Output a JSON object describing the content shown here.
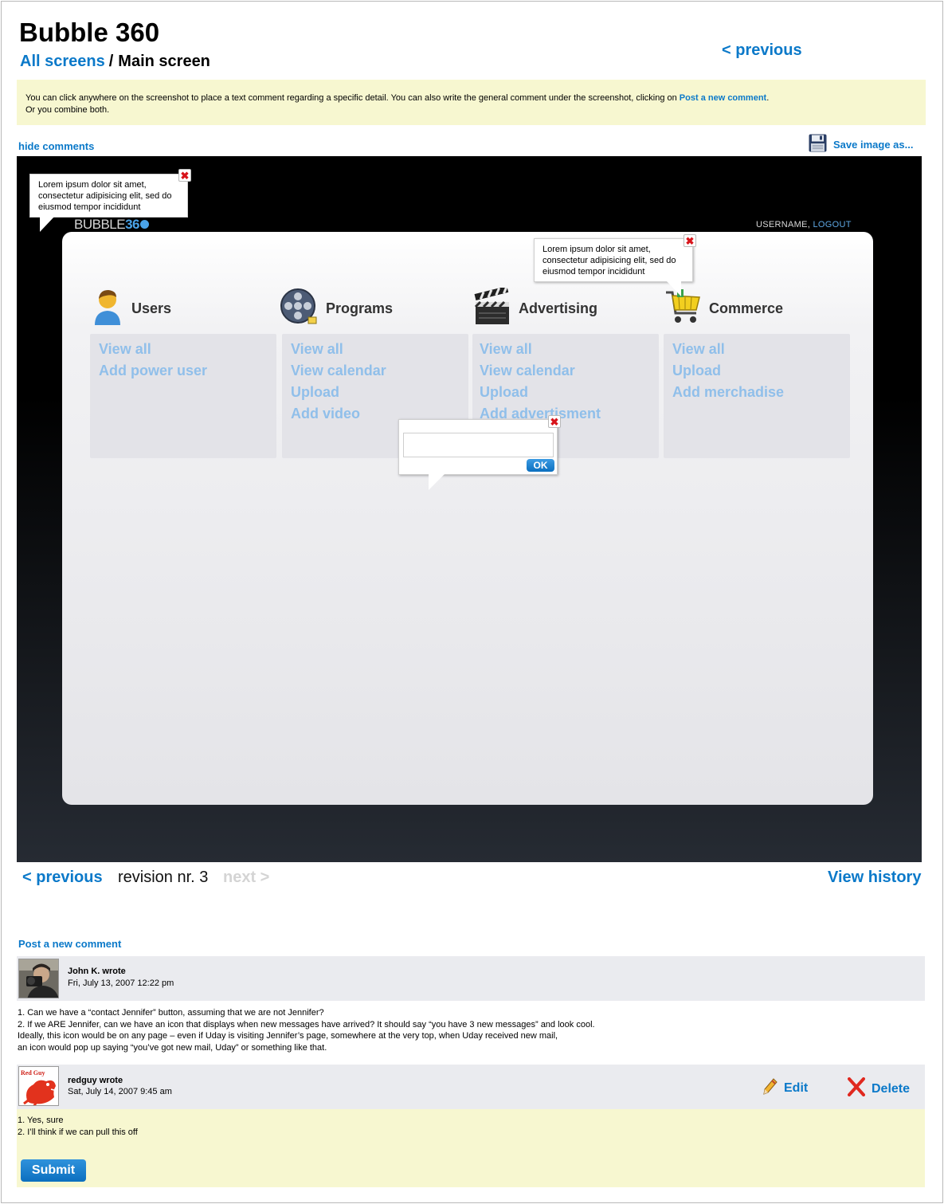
{
  "header": {
    "app_title": "Bubble 360",
    "breadcrumb_root": "All screens",
    "breadcrumb_separator": "/",
    "breadcrumb_current": "Main screen",
    "previous_label": "< previous"
  },
  "info": {
    "text_before_link": "You can click anywhere on the screenshot to place a text comment regarding a specific detail. You can also write the general comment under  the screenshot, clicking on",
    "link_label": "Post a new comment",
    "text_after_link": ".",
    "second_line": "Or you combine both."
  },
  "toolbar": {
    "hide_comments_label": "hide comments",
    "save_image_label": "Save image as...",
    "save_icon": "floppy-disk-icon"
  },
  "screenshot": {
    "logo_text": "BUBBLE",
    "logo_number": "36",
    "user_label": "USERNAME,",
    "logout_label": "LOGOUT",
    "categories": [
      {
        "title": "Users",
        "icon": "user-icon",
        "links": [
          "View all",
          "Add power user"
        ]
      },
      {
        "title": "Programs",
        "icon": "film-reel-icon",
        "links": [
          "View all",
          "View calendar",
          "Upload",
          "Add video"
        ]
      },
      {
        "title": "Advertising",
        "icon": "clapperboard-icon",
        "links": [
          "View all",
          "View calendar",
          "Upload",
          "Add advertisment"
        ]
      },
      {
        "title": "Commerce",
        "icon": "shopping-cart-icon",
        "links": [
          "View all",
          "Upload",
          "Add merchadise"
        ]
      }
    ],
    "comment_bubble_1": "Lorem ipsum dolor sit amet, consectetur adipisicing elit, sed do eiusmod tempor incididunt",
    "comment_bubble_2": "Lorem ipsum dolor sit amet, consectetur adipisicing elit, sed do eiusmod tempor incididunt",
    "new_comment": {
      "value": "",
      "ok_label": "OK"
    }
  },
  "revision_nav": {
    "previous_label": "< previous",
    "revision_label": "revision nr. 3",
    "next_label": "next >",
    "view_history_label": "View history"
  },
  "comments": {
    "post_new_label": "Post a new comment",
    "items": [
      {
        "author": "John K. wrote",
        "date": "Fri, July 13, 2007 12:22 pm",
        "lines": [
          "1. Can we have a “contact Jennifer” button, assuming that we are not Jennifer?",
          "2. If we ARE Jennifer, can we have an icon that displays when new messages have arrived?  It should say “you have 3 new messages” and look cool.",
          "Ideally, this icon would be on any page – even if Uday is visiting Jennifer’s page, somewhere at the very top, when Uday received new mail,",
          "an icon would pop up saying “you’ve got new mail, Uday” or something like that."
        ]
      },
      {
        "author": "redguy wrote",
        "date": "Sat, July 14, 2007 9:45 am",
        "avatar_text": "Red Guy",
        "edit_label": "Edit",
        "delete_label": "Delete",
        "lines": [
          "1. Yes, sure",
          "2. I’ll think if we can pull this off"
        ]
      }
    ],
    "submit_label": "Submit"
  },
  "colors": {
    "link_blue": "#0b79c9",
    "info_yellow": "#f7f7d0",
    "comment_header_gray": "#eaebef",
    "menu_link_light_blue": "#90bfea",
    "close_red": "#d8141b"
  }
}
